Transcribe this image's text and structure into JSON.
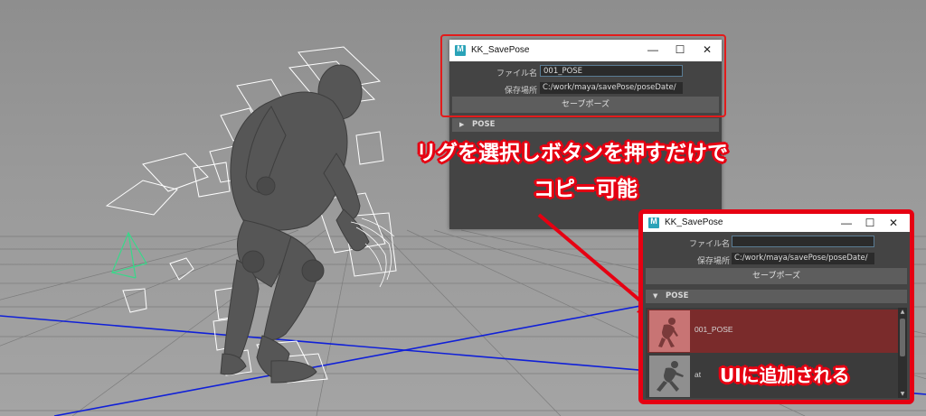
{
  "colors": {
    "highlight": "#e60012",
    "window_bg": "#444444",
    "field_bg": "#2b2b2b",
    "button_bg": "#5d5d5d",
    "selected_pose": "#7a2b2b"
  },
  "viewport": {
    "background": "maya-3d-viewport-grid"
  },
  "window_back": {
    "title": "KK_SavePose",
    "controls": [
      "—",
      "☐",
      "✕"
    ],
    "filename_label": "ファイル名",
    "filename_value": "001_POSE",
    "location_label": "保存場所",
    "location_value": "C:/work/maya/savePose/poseDate/",
    "save_button": "セーブポーズ",
    "pose_frame": "POSE"
  },
  "window_front": {
    "title": "KK_SavePose",
    "controls": [
      "—",
      "☐",
      "✕"
    ],
    "filename_label": "ファイル名",
    "filename_value": "",
    "location_label": "保存場所",
    "location_value": "C:/work/maya/savePose/poseDate/",
    "save_button": "セーブポーズ",
    "pose_frame": "POSE",
    "poses": [
      {
        "name": "001_POSE",
        "selected": true
      },
      {
        "name": "at",
        "selected": false
      }
    ]
  },
  "annotations": {
    "line1": "リグを選択しボタンを押すだけで",
    "line2": "コピー可能",
    "added": "UIに追加される"
  }
}
